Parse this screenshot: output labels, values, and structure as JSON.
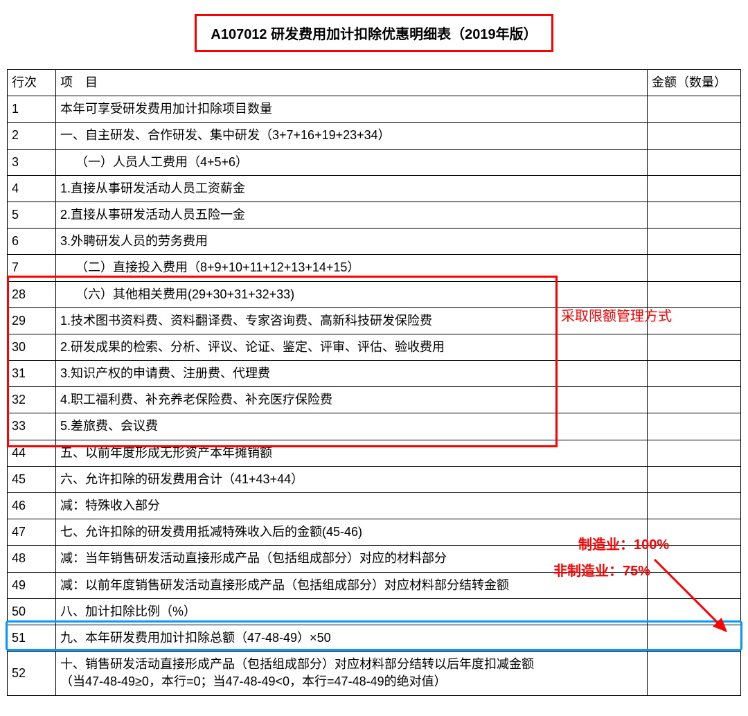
{
  "title": "A107012 研发费用加计扣除优惠明细表（2019年版）",
  "headers": {
    "row": "行次",
    "item": "项 目",
    "amount": "金额（数量）"
  },
  "rows": [
    {
      "n": "1",
      "item": "本年可享受研发费用加计扣除项目数量",
      "indent": 0
    },
    {
      "n": "2",
      "item": "一、自主研发、合作研发、集中研发（3+7+16+19+23+34）",
      "indent": 0
    },
    {
      "n": "3",
      "item": "（一）人员人工费用（4+5+6）",
      "indent": 1
    },
    {
      "n": "4",
      "item": "1.直接从事研发活动人员工资薪金",
      "indent": 0
    },
    {
      "n": "5",
      "item": "2.直接从事研发活动人员五险一金",
      "indent": 0
    },
    {
      "n": "6",
      "item": "3.外聘研发人员的劳务费用",
      "indent": 0
    },
    {
      "n": "7",
      "item": "（二）直接投入费用（8+9+10+11+12+13+14+15）",
      "indent": 1
    },
    {
      "n": "28",
      "item": "（六）其他相关费用(29+30+31+32+33)",
      "indent": 1
    },
    {
      "n": "29",
      "item": "1.技术图书资料费、资料翻译费、专家咨询费、高新科技研发保险费",
      "indent": 0
    },
    {
      "n": "30",
      "item": "2.研发成果的检索、分析、评议、论证、鉴定、评审、评估、验收费用",
      "indent": 0
    },
    {
      "n": "31",
      "item": "3.知识产权的申请费、注册费、代理费",
      "indent": 0
    },
    {
      "n": "32",
      "item": "4.职工福利费、补充养老保险费、补充医疗保险费",
      "indent": 0
    },
    {
      "n": "33",
      "item": "5.差旅费、会议费",
      "indent": 0
    },
    {
      "n": "44",
      "item": "五、以前年度形成无形资产本年摊销额",
      "indent": 0
    },
    {
      "n": "45",
      "item": "六、允许扣除的研发费用合计（41+43+44）",
      "indent": 0
    },
    {
      "n": "46",
      "item": "减：特殊收入部分",
      "indent": 0
    },
    {
      "n": "47",
      "item": "七、允许扣除的研发费用抵减特殊收入后的金额(45-46)",
      "indent": 0
    },
    {
      "n": "48",
      "item": "减：当年销售研发活动直接形成产品（包括组成部分）对应的材料部分",
      "indent": 0
    },
    {
      "n": "49",
      "item": "减：以前年度销售研发活动直接形成产品（包括组成部分）对应材料部分结转金额",
      "indent": 0
    },
    {
      "n": "50",
      "item": "八、加计扣除比例（%）",
      "indent": 0
    },
    {
      "n": "51",
      "item": "九、本年研发费用加计扣除总额（47-48-49）×50",
      "indent": 0
    },
    {
      "n": "52",
      "item": "十、销售研发活动直接形成产品（包括组成部分）对应材料部分结转以后年度扣减金额\n（当47-48-49≥0，本行=0；当47-48-49<0，本行=47-48-49的绝对值）",
      "indent": 0
    }
  ],
  "annotations": {
    "quota": "采取限额管理方式",
    "mfg": "制造业：100%",
    "nonmfg": "非制造业：75%"
  }
}
